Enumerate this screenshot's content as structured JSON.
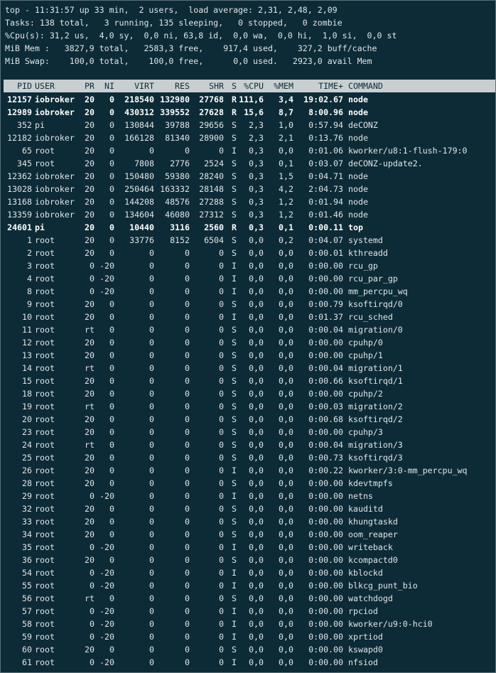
{
  "summary": [
    "top - 11:31:57 up 33 min,  2 users,  load average: 2,31, 2,48, 2,09",
    "Tasks: 138 total,   3 running, 135 sleeping,   0 stopped,   0 zombie",
    "%Cpu(s): 31,2 us,  4,0 sy,  0,0 ni, 63,8 id,  0,0 wa,  0,0 hi,  1,0 si,  0,0 st",
    "MiB Mem :   3827,9 total,   2583,3 free,    917,4 used,    327,2 buff/cache",
    "MiB Swap:    100,0 total,    100,0 free,      0,0 used.   2923,0 avail Mem"
  ],
  "columns": [
    "PID",
    "USER",
    "PR",
    "NI",
    "VIRT",
    "RES",
    "SHR",
    "S",
    "%CPU",
    "%MEM",
    "TIME+",
    "COMMAND"
  ],
  "processes": [
    [
      "12157",
      "iobroker",
      "20",
      "0",
      "218540",
      "132980",
      "27768",
      "R",
      "111,6",
      "3,4",
      "19:02.67",
      "node",
      true
    ],
    [
      "12989",
      "iobroker",
      "20",
      "0",
      "430312",
      "339552",
      "27628",
      "R",
      "15,6",
      "8,7",
      "8:00.96",
      "node",
      true
    ],
    [
      "352",
      "pi",
      "20",
      "0",
      "130844",
      "39788",
      "29656",
      "S",
      "2,3",
      "1,0",
      "0:57.94",
      "deCONZ",
      false
    ],
    [
      "12182",
      "iobroker",
      "20",
      "0",
      "166128",
      "81340",
      "28900",
      "S",
      "2,3",
      "2,1",
      "0:13.76",
      "node",
      false
    ],
    [
      "65",
      "root",
      "20",
      "0",
      "0",
      "0",
      "0",
      "I",
      "0,3",
      "0,0",
      "0:01.06",
      "kworker/u8:1-flush-179:0",
      false
    ],
    [
      "345",
      "root",
      "20",
      "0",
      "7808",
      "2776",
      "2524",
      "S",
      "0,3",
      "0,1",
      "0:03.07",
      "deCONZ-update2.",
      false
    ],
    [
      "12362",
      "iobroker",
      "20",
      "0",
      "150480",
      "59380",
      "28240",
      "S",
      "0,3",
      "1,5",
      "0:04.71",
      "node",
      false
    ],
    [
      "13028",
      "iobroker",
      "20",
      "0",
      "250464",
      "163332",
      "28148",
      "S",
      "0,3",
      "4,2",
      "2:04.73",
      "node",
      false
    ],
    [
      "13168",
      "iobroker",
      "20",
      "0",
      "144208",
      "48576",
      "27288",
      "S",
      "0,3",
      "1,2",
      "0:01.94",
      "node",
      false
    ],
    [
      "13359",
      "iobroker",
      "20",
      "0",
      "134604",
      "46080",
      "27312",
      "S",
      "0,3",
      "1,2",
      "0:01.46",
      "node",
      false
    ],
    [
      "24601",
      "pi",
      "20",
      "0",
      "10440",
      "3116",
      "2560",
      "R",
      "0,3",
      "0,1",
      "0:00.11",
      "top",
      true
    ],
    [
      "1",
      "root",
      "20",
      "0",
      "33776",
      "8152",
      "6504",
      "S",
      "0,0",
      "0,2",
      "0:04.07",
      "systemd",
      false
    ],
    [
      "2",
      "root",
      "20",
      "0",
      "0",
      "0",
      "0",
      "S",
      "0,0",
      "0,0",
      "0:00.01",
      "kthreadd",
      false
    ],
    [
      "3",
      "root",
      "0",
      "-20",
      "0",
      "0",
      "0",
      "I",
      "0,0",
      "0,0",
      "0:00.00",
      "rcu_gp",
      false
    ],
    [
      "4",
      "root",
      "0",
      "-20",
      "0",
      "0",
      "0",
      "I",
      "0,0",
      "0,0",
      "0:00.00",
      "rcu_par_gp",
      false
    ],
    [
      "8",
      "root",
      "0",
      "-20",
      "0",
      "0",
      "0",
      "I",
      "0,0",
      "0,0",
      "0:00.00",
      "mm_percpu_wq",
      false
    ],
    [
      "9",
      "root",
      "20",
      "0",
      "0",
      "0",
      "0",
      "S",
      "0,0",
      "0,0",
      "0:00.79",
      "ksoftirqd/0",
      false
    ],
    [
      "10",
      "root",
      "20",
      "0",
      "0",
      "0",
      "0",
      "I",
      "0,0",
      "0,0",
      "0:01.37",
      "rcu_sched",
      false
    ],
    [
      "11",
      "root",
      "rt",
      "0",
      "0",
      "0",
      "0",
      "S",
      "0,0",
      "0,0",
      "0:00.04",
      "migration/0",
      false
    ],
    [
      "12",
      "root",
      "20",
      "0",
      "0",
      "0",
      "0",
      "S",
      "0,0",
      "0,0",
      "0:00.00",
      "cpuhp/0",
      false
    ],
    [
      "13",
      "root",
      "20",
      "0",
      "0",
      "0",
      "0",
      "S",
      "0,0",
      "0,0",
      "0:00.00",
      "cpuhp/1",
      false
    ],
    [
      "14",
      "root",
      "rt",
      "0",
      "0",
      "0",
      "0",
      "S",
      "0,0",
      "0,0",
      "0:00.04",
      "migration/1",
      false
    ],
    [
      "15",
      "root",
      "20",
      "0",
      "0",
      "0",
      "0",
      "S",
      "0,0",
      "0,0",
      "0:00.66",
      "ksoftirqd/1",
      false
    ],
    [
      "18",
      "root",
      "20",
      "0",
      "0",
      "0",
      "0",
      "S",
      "0,0",
      "0,0",
      "0:00.00",
      "cpuhp/2",
      false
    ],
    [
      "19",
      "root",
      "rt",
      "0",
      "0",
      "0",
      "0",
      "S",
      "0,0",
      "0,0",
      "0:00.03",
      "migration/2",
      false
    ],
    [
      "20",
      "root",
      "20",
      "0",
      "0",
      "0",
      "0",
      "S",
      "0,0",
      "0,0",
      "0:00.68",
      "ksoftirqd/2",
      false
    ],
    [
      "23",
      "root",
      "20",
      "0",
      "0",
      "0",
      "0",
      "S",
      "0,0",
      "0,0",
      "0:00.00",
      "cpuhp/3",
      false
    ],
    [
      "24",
      "root",
      "rt",
      "0",
      "0",
      "0",
      "0",
      "S",
      "0,0",
      "0,0",
      "0:00.04",
      "migration/3",
      false
    ],
    [
      "25",
      "root",
      "20",
      "0",
      "0",
      "0",
      "0",
      "S",
      "0,0",
      "0,0",
      "0:00.73",
      "ksoftirqd/3",
      false
    ],
    [
      "26",
      "root",
      "20",
      "0",
      "0",
      "0",
      "0",
      "I",
      "0,0",
      "0,0",
      "0:00.22",
      "kworker/3:0-mm_percpu_wq",
      false
    ],
    [
      "28",
      "root",
      "20",
      "0",
      "0",
      "0",
      "0",
      "S",
      "0,0",
      "0,0",
      "0:00.00",
      "kdevtmpfs",
      false
    ],
    [
      "29",
      "root",
      "0",
      "-20",
      "0",
      "0",
      "0",
      "I",
      "0,0",
      "0,0",
      "0:00.00",
      "netns",
      false
    ],
    [
      "32",
      "root",
      "20",
      "0",
      "0",
      "0",
      "0",
      "S",
      "0,0",
      "0,0",
      "0:00.00",
      "kauditd",
      false
    ],
    [
      "33",
      "root",
      "20",
      "0",
      "0",
      "0",
      "0",
      "S",
      "0,0",
      "0,0",
      "0:00.00",
      "khungtaskd",
      false
    ],
    [
      "34",
      "root",
      "20",
      "0",
      "0",
      "0",
      "0",
      "S",
      "0,0",
      "0,0",
      "0:00.00",
      "oom_reaper",
      false
    ],
    [
      "35",
      "root",
      "0",
      "-20",
      "0",
      "0",
      "0",
      "I",
      "0,0",
      "0,0",
      "0:00.00",
      "writeback",
      false
    ],
    [
      "36",
      "root",
      "20",
      "0",
      "0",
      "0",
      "0",
      "S",
      "0,0",
      "0,0",
      "0:00.00",
      "kcompactd0",
      false
    ],
    [
      "54",
      "root",
      "0",
      "-20",
      "0",
      "0",
      "0",
      "I",
      "0,0",
      "0,0",
      "0:00.00",
      "kblockd",
      false
    ],
    [
      "55",
      "root",
      "0",
      "-20",
      "0",
      "0",
      "0",
      "I",
      "0,0",
      "0,0",
      "0:00.00",
      "blkcg_punt_bio",
      false
    ],
    [
      "56",
      "root",
      "rt",
      "0",
      "0",
      "0",
      "0",
      "S",
      "0,0",
      "0,0",
      "0:00.00",
      "watchdogd",
      false
    ],
    [
      "57",
      "root",
      "0",
      "-20",
      "0",
      "0",
      "0",
      "I",
      "0,0",
      "0,0",
      "0:00.00",
      "rpciod",
      false
    ],
    [
      "58",
      "root",
      "0",
      "-20",
      "0",
      "0",
      "0",
      "I",
      "0,0",
      "0,0",
      "0:00.00",
      "kworker/u9:0-hci0",
      false
    ],
    [
      "59",
      "root",
      "0",
      "-20",
      "0",
      "0",
      "0",
      "I",
      "0,0",
      "0,0",
      "0:00.00",
      "xprtiod",
      false
    ],
    [
      "60",
      "root",
      "20",
      "0",
      "0",
      "0",
      "0",
      "S",
      "0,0",
      "0,0",
      "0:00.00",
      "kswapd0",
      false
    ],
    [
      "61",
      "root",
      "0",
      "-20",
      "0",
      "0",
      "0",
      "I",
      "0,0",
      "0,0",
      "0:00.00",
      "nfsiod",
      false
    ]
  ],
  "colors": {
    "background": "#0d2b36",
    "foreground": "#dfe6e8",
    "header_bar": "#c9cfd1"
  }
}
